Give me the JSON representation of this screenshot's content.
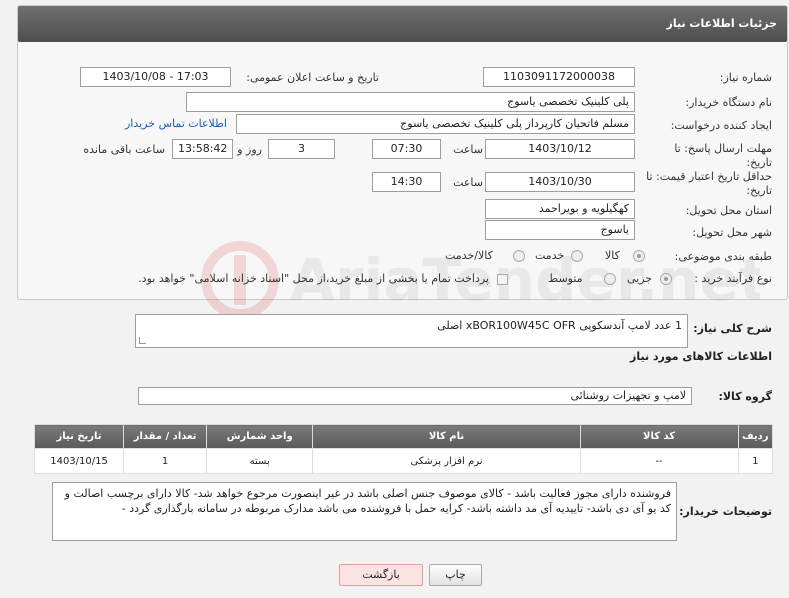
{
  "header": {
    "title": "جزئیات اطلاعات نیاز"
  },
  "form": {
    "need_number_label": "شماره نیاز:",
    "need_number": "1103091172000038",
    "announce_label": "تاریخ و ساعت اعلان عمومی:",
    "announce_value": "1403/10/08 - 17:03",
    "buyer_org_label": "نام دستگاه خریدار:",
    "buyer_org": "پلی کلینیک تخصصی یاسوج",
    "creator_label": "ایجاد کننده درخواست:",
    "creator": "مسلم فاتحیان کارپرداز  پلی کلینیک تخصصی یاسوج",
    "contact_link": "اطلاعات تماس خریدار",
    "deadline_label_1": "مهلت ارسال پاسخ: تا",
    "deadline_label_2": "تاریخ:",
    "deadline_date": "1403/10/12",
    "time_label": "ساعت",
    "deadline_time": "07:30",
    "days_value": "3",
    "days_label": "روز و",
    "remaining_time": "13:58:42",
    "remaining_label": "ساعت باقی مانده",
    "validity_label_1": "حداقل تاریخ اعتبار قیمت: تا",
    "validity_label_2": "تاریخ:",
    "validity_date": "1403/10/30",
    "validity_time": "14:30",
    "province_label": "استان محل تحویل:",
    "province": "کهگیلویه و بویراحمد",
    "city_label": "شهر محل تحویل:",
    "city": "یاسوج",
    "category_label": "طبقه بندی موضوعی:",
    "category_options": [
      "کالا",
      "خدمت",
      "کالا/خدمت"
    ],
    "process_label": "نوع فرآیند خرید :",
    "process_options": [
      "جزیی",
      "متوسط"
    ],
    "treasury_text": "پرداخت تمام یا بخشی از مبلغ خرید،از محل \"اسناد خزانه اسلامی\" خواهد بود."
  },
  "summary": {
    "label": "شرح کلی نیاز:",
    "text": "1 عدد لامپ آندسکوپی xBOR100W45C OFR   اصلی"
  },
  "goods": {
    "section_title": "اطلاعات کالاهای مورد نیاز",
    "group_label": "گروه کالا:",
    "group_value": "لامپ و تجهیزات روشنائی",
    "columns": [
      "ردیف",
      "کد کالا",
      "نام کالا",
      "واحد شمارش",
      "تعداد / مقدار",
      "تاریخ نیاز"
    ],
    "rows": [
      {
        "row": "1",
        "code": "--",
        "name": "نرم افزار پزشکی",
        "unit": "بسته",
        "qty": "1",
        "date": "1403/10/15"
      }
    ]
  },
  "notes": {
    "label": "توضیحات خریدار:",
    "text": "فروشنده دارای مجوز فعالیت باشد - کالای موصوف جنس اصلی باشد در غیر اینصورت مرجوع خواهد شد- کالا دارای برچسب اصالت و کد یو آی دی باشد-  تاییدیه آی مد داشته باشد- کرایه حمل با فروشنده می باشد مدارک مربوطه در سامانه بارگذاری گردد -"
  },
  "buttons": {
    "print": "چاپ",
    "back": "بازگشت"
  },
  "watermark": {
    "text": "AriaTender.net"
  }
}
